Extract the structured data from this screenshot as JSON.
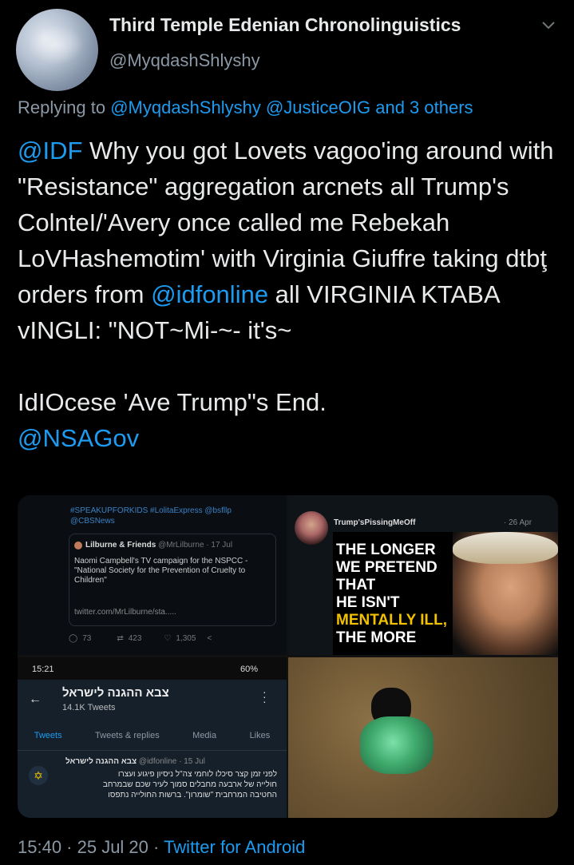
{
  "author": {
    "name": "Third Temple Edenian Chronolinguistics",
    "handle": "@MyqdashShlyshy"
  },
  "reply": {
    "prefix": "Replying to",
    "to": "@MyqdashShlyshy @JusticeOIG",
    "and": "and 3 others"
  },
  "tweet": {
    "mention1": "@IDF",
    "text1": " Why you got Lovets vagoo'ing around with \"Resistance\" aggregation arcnets all Trump's ColnteI/'Avery once called me Rebekah LoVHashemotim' with Virginia Giuffre taking dtbţ orders from ",
    "mention2": "@idfonline",
    "text2": " all VIRGINIA KTABA vINGLI: \"NOT~Mi-~- it's~",
    "line2": "IdIOcese 'Ave Trump\"s End.",
    "mention3": "@NSAGov"
  },
  "media1": {
    "hashtags": "#SPEAKUPFORKIDS #LolitaExpress @bsfllp",
    "cbs": "@CBSNews",
    "quote_name": "Lilburne & Friends",
    "quote_handle": "@MrLilburne · 17 Jul",
    "quote_text": "Naomi Campbell's TV campaign for the NSPCC - \"National Society for the Prevention of Cruelty to Children\"",
    "quote_link": "twitter.com/MrLilburne/sta.....",
    "replies": "73",
    "retweets": "423",
    "likes": "1,305"
  },
  "media2": {
    "user": "Trump'sPissingMeOff",
    "date": "· 26 Apr",
    "headline1": "THE LONGER",
    "headline2": "WE PRETEND",
    "headline3": "THAT",
    "headline4": "HE ISN'T",
    "headline5": "MENTALLY ILL,",
    "headline6": "THE MORE"
  },
  "media3": {
    "time": "15:21",
    "battery": "60%",
    "profile_name": "צבא ההגנה לישראל",
    "tweets_count": "14.1K Tweets",
    "tabs": [
      "Tweets",
      "Tweets & replies",
      "Media",
      "Likes"
    ],
    "tweet_name": "צבא ההגנה לישראל",
    "tweet_handle": "@idfonline · 15 Jul",
    "tweet_line1": "לפני זמן קצר סיכלו לוחמי צה\"ל ניסיון פיגוע ועצרו",
    "tweet_line2": "חולייה של ארבעה מחבלים סמוך לעיר שכם שבמרחב",
    "tweet_line3": "החטיבה המרחבית \"שומרון\". ברשות החולייה נתפסו"
  },
  "footer": {
    "time": "15:40 · 25 Jul 20",
    "sep": " · ",
    "client": "Twitter for Android"
  },
  "colors": {
    "link": "#1d9bf0",
    "background": "#000000",
    "headline_yellow": "#f2c200"
  }
}
